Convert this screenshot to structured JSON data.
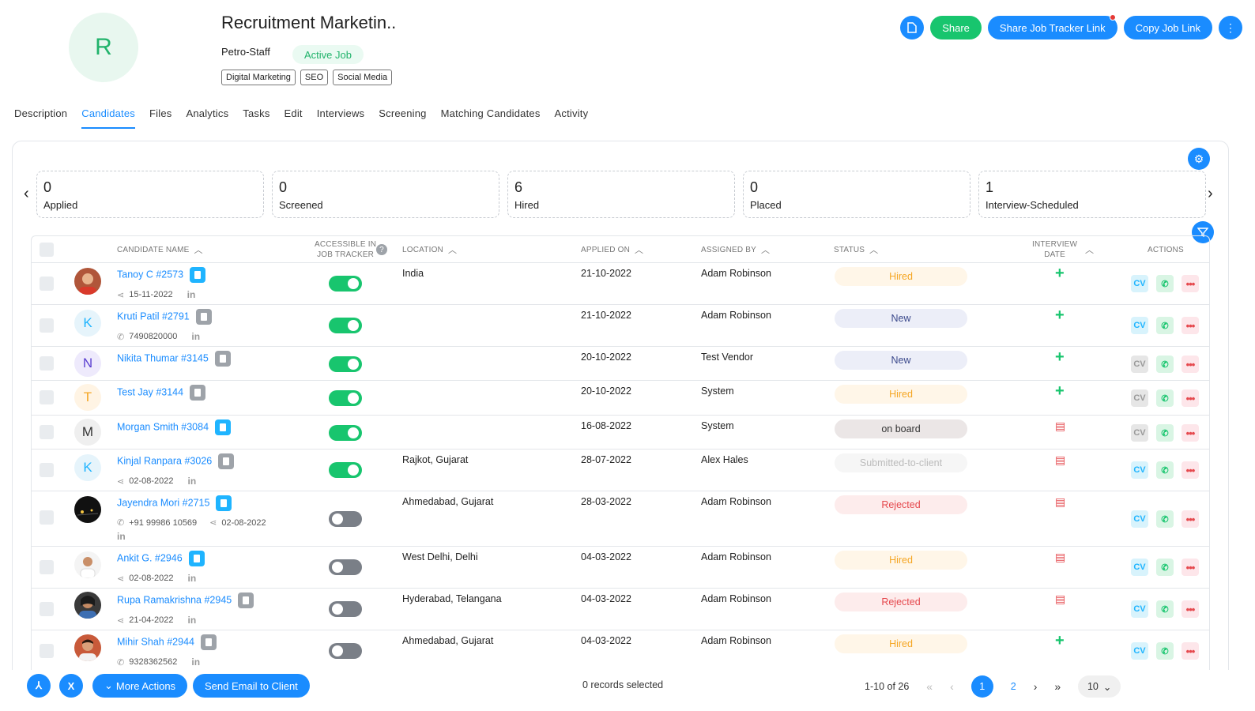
{
  "header": {
    "avatar_letter": "R",
    "job_title": "Recruitment Marketin..",
    "company": "Petro-Staff",
    "status_badge": "Active Job",
    "tags": [
      "Digital Marketing",
      "SEO",
      "Social Media"
    ],
    "actions": {
      "share": "Share",
      "share_tracker": "Share Job Tracker Link",
      "copy_link": "Copy Job Link"
    }
  },
  "tabs": [
    "Description",
    "Candidates",
    "Files",
    "Analytics",
    "Tasks",
    "Edit",
    "Interviews",
    "Screening",
    "Matching Candidates",
    "Activity"
  ],
  "active_tab": "Candidates",
  "stats": [
    {
      "count": "0",
      "label": "Applied"
    },
    {
      "count": "0",
      "label": "Screened"
    },
    {
      "count": "6",
      "label": "Hired"
    },
    {
      "count": "0",
      "label": "Placed"
    },
    {
      "count": "1",
      "label": "Interview-Scheduled"
    }
  ],
  "table": {
    "columns": {
      "name": "Candidate Name",
      "tracker_1": "Accessible in",
      "tracker_2": "Job Tracker",
      "location": "Location",
      "applied": "Applied On",
      "assigned": "Assigned By",
      "status": "Status",
      "interview_1": "Interview",
      "interview_2": "Date",
      "actions": "Actions"
    },
    "rows": [
      {
        "name": "Tanoy C #2573",
        "sub": "15-11-2022",
        "location": "India",
        "applied": "21-10-2022",
        "assigned": "Adam Robinson",
        "status": "Hired"
      },
      {
        "name": "Kruti Patil #2791",
        "sub": "7490820000",
        "location": "",
        "applied": "21-10-2022",
        "assigned": "Adam Robinson",
        "status": "New",
        "letter": "K"
      },
      {
        "name": "Nikita Thumar #3145",
        "location": "",
        "applied": "20-10-2022",
        "assigned": "Test Vendor",
        "status": "New",
        "letter": "N"
      },
      {
        "name": "Test Jay #3144",
        "location": "",
        "applied": "20-10-2022",
        "assigned": "System",
        "status": "Hired",
        "letter": "T"
      },
      {
        "name": "Morgan Smith #3084",
        "location": "",
        "applied": "16-08-2022",
        "assigned": "System",
        "status": "on board",
        "letter": "M"
      },
      {
        "name": "Kinjal Ranpara #3026",
        "sub": "02-08-2022",
        "location": "Rajkot, Gujarat",
        "applied": "28-07-2022",
        "assigned": "Alex Hales",
        "status": "Submitted-to-client",
        "letter": "K"
      },
      {
        "name": "Jayendra Mori #2715",
        "sub_phone": "+91 99986 10569",
        "sub_date": "02-08-2022",
        "location": "Ahmedabad, Gujarat",
        "applied": "28-03-2022",
        "assigned": "Adam Robinson",
        "status": "Rejected"
      },
      {
        "name": "Ankit G. #2946",
        "sub": "02-08-2022",
        "location": "West Delhi, Delhi",
        "applied": "04-03-2022",
        "assigned": "Adam Robinson",
        "status": "Hired"
      },
      {
        "name": "Rupa Ramakrishna #2945",
        "sub": "21-04-2022",
        "location": "Hyderabad, Telangana",
        "applied": "04-03-2022",
        "assigned": "Adam Robinson",
        "status": "Rejected"
      },
      {
        "name": "Mihir Shah #2944",
        "sub": "9328362562",
        "location": "Ahmedabad, Gujarat",
        "applied": "04-03-2022",
        "assigned": "Adam Robinson",
        "status": "Hired"
      }
    ]
  },
  "footer": {
    "more_actions": "More Actions",
    "send_email": "Send Email to Client",
    "selected": "0 records selected",
    "range": "1-10 of 26",
    "page_1": "1",
    "page_2": "2",
    "per_page": "10"
  },
  "colors": {
    "primary": "#1a8cff",
    "success": "#18c56e",
    "hired": "#f5a623",
    "rejected": "#e5484d"
  }
}
